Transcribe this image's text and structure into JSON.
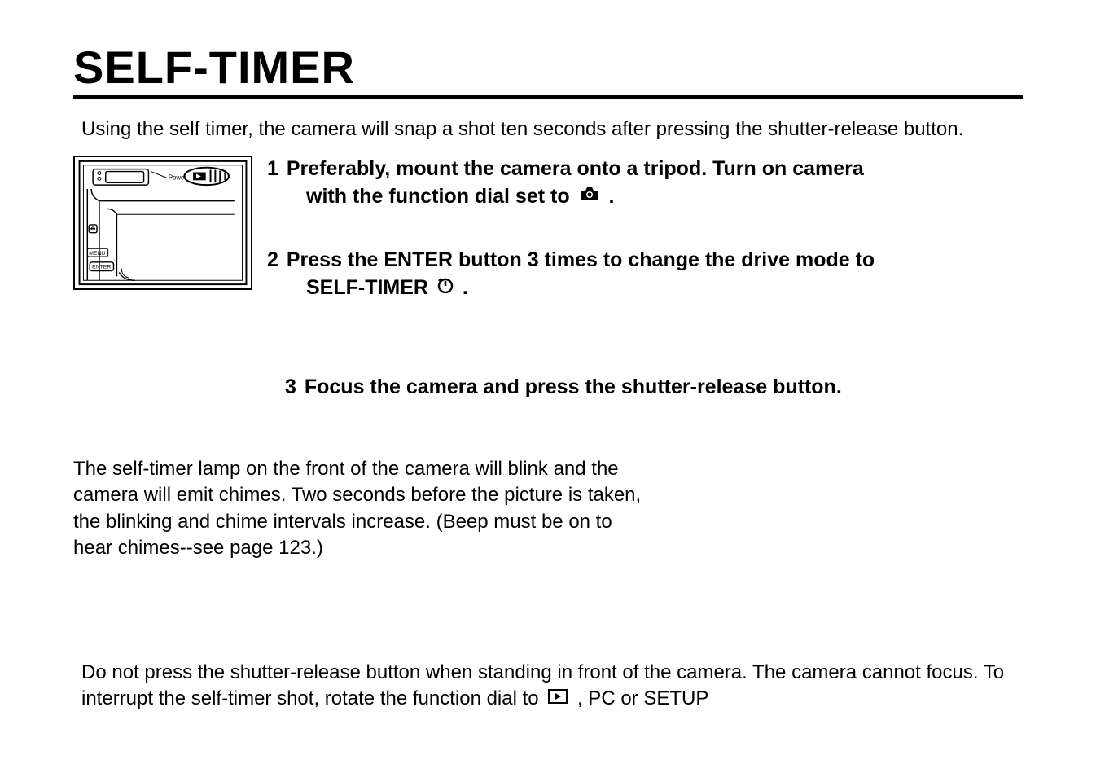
{
  "title": "SELF-TIMER",
  "intro": "Using the self timer, the camera will snap a shot ten seconds after pressing the shutter-release button.",
  "steps": {
    "s1": {
      "num": "1",
      "text_a": "Preferably, mount the camera onto a tripod. Turn on camera",
      "text_b": "with the function dial set to",
      "text_c": "."
    },
    "s2": {
      "num": "2",
      "text_a": "Press the ENTER button 3 times to change the drive mode to",
      "text_b": "SELF-TIMER",
      "text_c": "."
    },
    "s3": {
      "num": "3",
      "text_a": "Focus the camera and press the shutter-release button."
    }
  },
  "para1": "The self-timer lamp on the front of the camera will blink and the camera will emit chimes. Two seconds before the picture is taken, the blinking and chime intervals increase. (Beep must be on to hear chimes--see page 123.)",
  "note_a": "Do not press the shutter-release button when standing in front of the camera. The camera cannot focus. To interrupt the self-timer shot, rotate the function dial to",
  "note_b": ", PC or SETUP",
  "illustration_labels": {
    "power": "Power",
    "menu": "MENU",
    "enter": "ENTER"
  }
}
